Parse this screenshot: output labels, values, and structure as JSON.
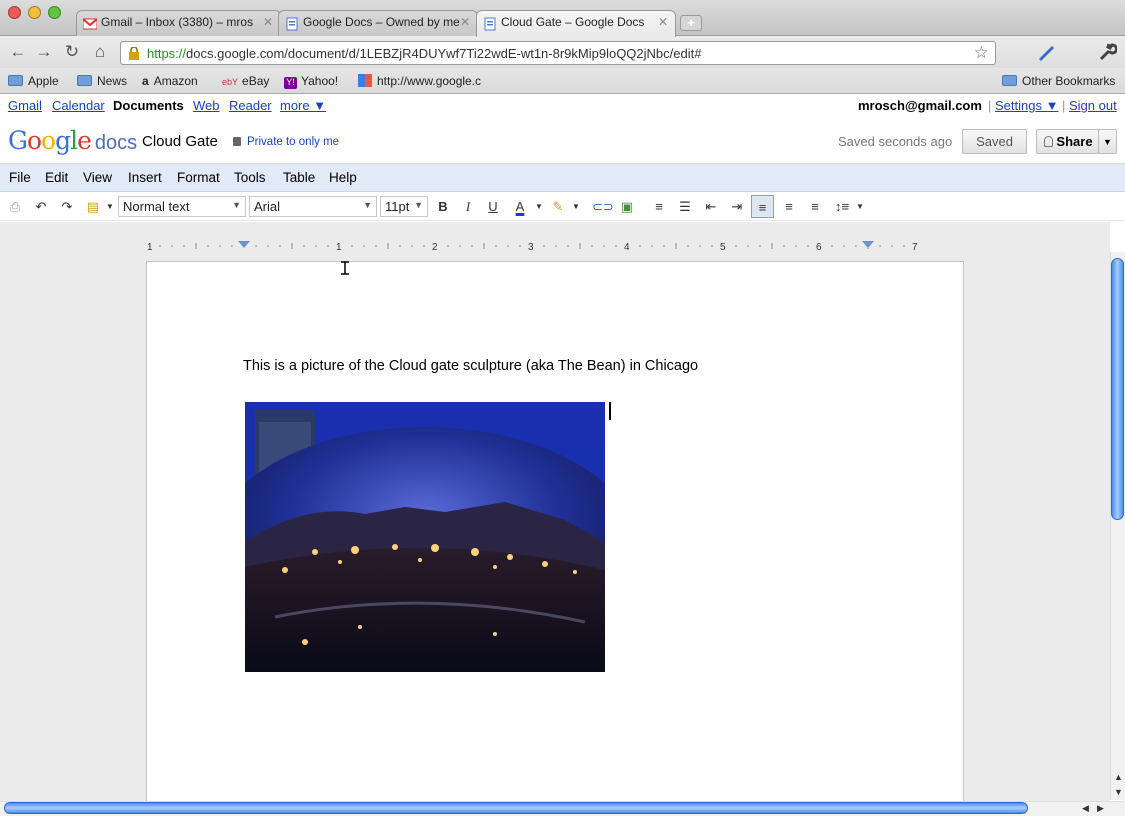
{
  "browser": {
    "tabs": [
      {
        "label": "Gmail – Inbox (3380) – mros",
        "icon": "gmail-icon"
      },
      {
        "label": "Google Docs – Owned by me",
        "icon": "docs-icon"
      },
      {
        "label": "Cloud Gate – Google Docs",
        "icon": "docs-icon",
        "active": true
      }
    ],
    "url_scheme": "https://",
    "url_rest": "docs.google.com/document/d/1LEBZjR4DUYwf7Ti22wdE-wt1n-8r9kMip9loQQ2jNbc/edit#",
    "bookmarks": [
      "Apple",
      "News",
      "Amazon",
      "eBay",
      "Yahoo!",
      "http://www.google.c"
    ],
    "other_bookmarks": "Other Bookmarks"
  },
  "gbar": {
    "links": [
      "Gmail",
      "Calendar",
      "Documents",
      "Web",
      "Reader",
      "more ▼"
    ],
    "email": "mrosch@gmail.com",
    "settings": "Settings ▼",
    "signout": "Sign out"
  },
  "header": {
    "logo_google": "Google",
    "logo_docs": "docs",
    "doc_title": "Cloud Gate",
    "privacy": "Private to only me",
    "save_status": "Saved seconds ago",
    "saved_button": "Saved",
    "share_button": "Share"
  },
  "menubar": [
    "File",
    "Edit",
    "View",
    "Insert",
    "Format",
    "Tools",
    "Table",
    "Help"
  ],
  "toolbar": {
    "style_select": "Normal text",
    "font_select": "Arial",
    "size_select": "11pt"
  },
  "ruler": {
    "labels": [
      "1",
      "1",
      "2",
      "3",
      "4",
      "5",
      "6",
      "7"
    ]
  },
  "document": {
    "body_text": "This is a picture of the Cloud gate sculpture (aka The Bean) in Chicago"
  },
  "colors": {
    "link": "#1a3fc4",
    "menubar_bg": "#e2eaf8",
    "scroll_thumb": "#4c8ef0"
  }
}
